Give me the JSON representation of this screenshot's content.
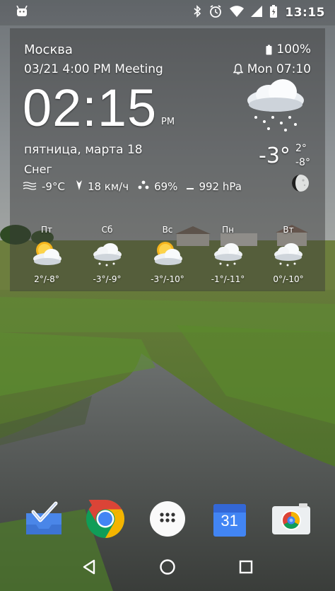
{
  "status_bar": {
    "time": "13:15",
    "icons": [
      "android-icon",
      "bluetooth-icon",
      "alarm-icon",
      "wifi-icon",
      "signal-icon",
      "battery-charging-icon"
    ]
  },
  "widget": {
    "city": "Москва",
    "battery": "100%",
    "event": "03/21 4:00 PM Meeting",
    "alarm": "Mon 07:10",
    "time": "02:15",
    "ampm": "PM",
    "date": "пятница, марта 18",
    "condition": "Снег",
    "feels_like": "-9°C",
    "wind": "18 км/ч",
    "humidity": "69%",
    "pressure": "992 hPa",
    "temp_now": "-3°",
    "temp_high": "2°",
    "temp_low": "-8°",
    "forecast": [
      {
        "day": "Пт",
        "temps": "2°/-8°",
        "icon": "sun-cloud-icon"
      },
      {
        "day": "Сб",
        "temps": "-3°/-9°",
        "icon": "snow-cloud-icon"
      },
      {
        "day": "Вс",
        "temps": "-3°/-10°",
        "icon": "sun-cloud-icon"
      },
      {
        "day": "Пн",
        "temps": "-1°/-11°",
        "icon": "snow-cloud-icon"
      },
      {
        "day": "Вт",
        "temps": "0°/-10°",
        "icon": "snow-cloud-icon"
      }
    ]
  },
  "dock": {
    "apps": [
      "inbox-app-icon",
      "chrome-app-icon",
      "app-drawer-icon",
      "calendar-app-icon",
      "camera-app-icon"
    ],
    "calendar_day": "31"
  },
  "nav": {
    "buttons": [
      "back-icon",
      "home-icon",
      "recents-icon"
    ]
  },
  "colors": {
    "widget_bg": "#5a5a5a",
    "grass": "#4d7a2a",
    "sky": "#8a8f92",
    "chrome_red": "#db4437",
    "chrome_yellow": "#f4b400",
    "chrome_green": "#0f9d58",
    "chrome_blue": "#4285f4"
  }
}
